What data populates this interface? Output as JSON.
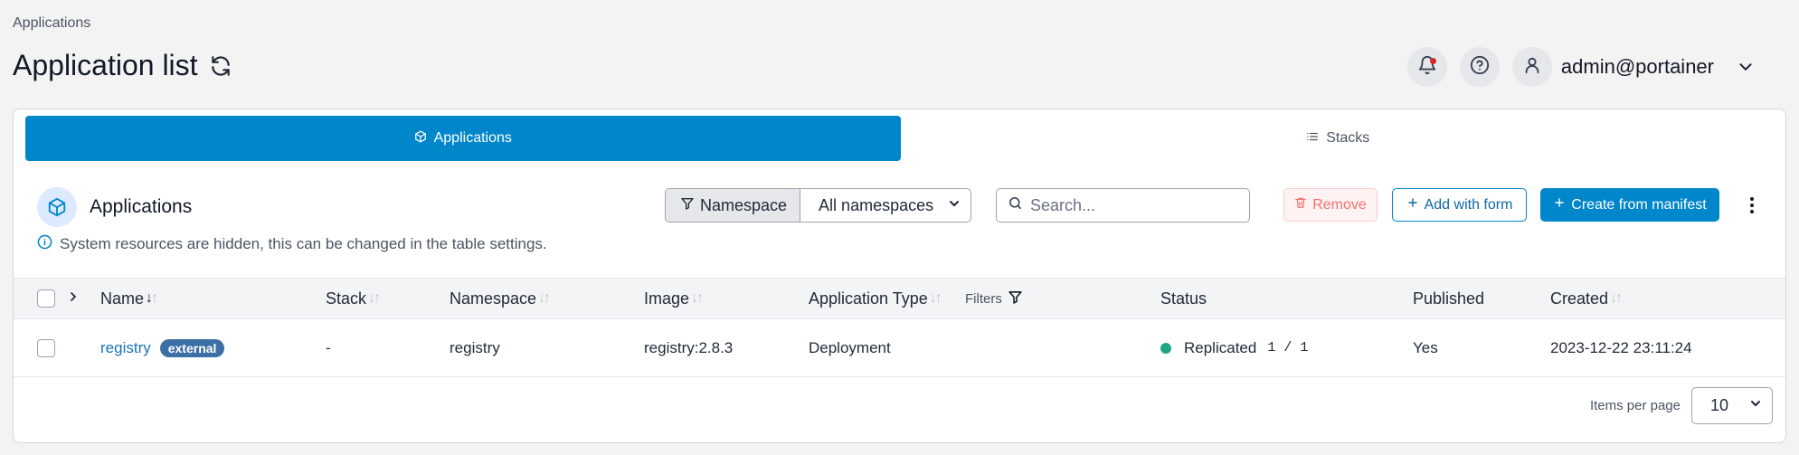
{
  "breadcrumb": "Applications",
  "page": {
    "title": "Application list"
  },
  "user": {
    "name": "admin@portainer"
  },
  "tabs": [
    {
      "label": "Applications",
      "active": true,
      "icon": "cube-icon"
    },
    {
      "label": "Stacks",
      "active": false,
      "icon": "list-icon"
    }
  ],
  "section": {
    "title": "Applications",
    "info": "System resources are hidden, this can be changed in the table settings."
  },
  "namespace_filter": {
    "label": "Namespace",
    "selected": "All namespaces"
  },
  "search": {
    "placeholder": "Search..."
  },
  "actions": {
    "remove": "Remove",
    "add_with_form": "Add with form",
    "create_from_manifest": "Create from manifest"
  },
  "table": {
    "headers": {
      "name": "Name",
      "stack": "Stack",
      "namespace": "Namespace",
      "image": "Image",
      "app_type": "Application Type",
      "filters": "Filters",
      "status": "Status",
      "published": "Published",
      "created": "Created"
    },
    "rows": [
      {
        "name": "registry",
        "badge": "external",
        "stack": "-",
        "namespace": "registry",
        "image": "registry:2.8.3",
        "app_type": "Deployment",
        "status": "Replicated",
        "replicas": "1 / 1",
        "published": "Yes",
        "created": "2023-12-22 23:11:24"
      }
    ]
  },
  "pagination": {
    "label": "Items per page",
    "selected": "10"
  },
  "colors": {
    "primary": "#0086ca",
    "status_ok": "#1fa785",
    "danger": "#dc2626"
  }
}
